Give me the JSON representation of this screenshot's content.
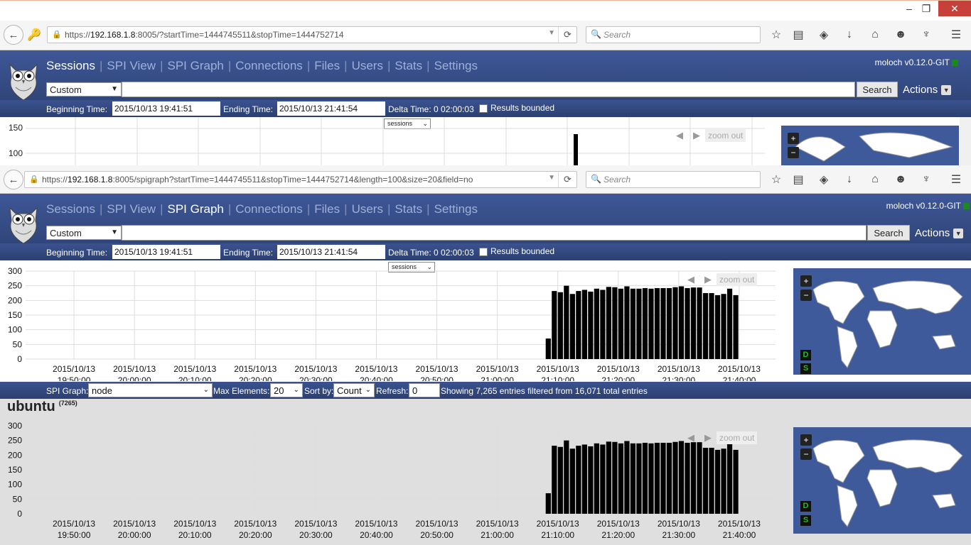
{
  "window": {
    "minimize": "–",
    "restore": "❐",
    "close": "✕"
  },
  "top_browser": {
    "url_host": "192.168.1.8",
    "url_scheme": "https://",
    "url_rest": ":8005/?startTime=1444745511&stopTime=1444752714",
    "search_placeholder": "Search"
  },
  "bottom_browser": {
    "url_host": "192.168.1.8",
    "url_scheme": "https://",
    "url_rest": ":8005/spigraph?startTime=1444745511&stopTime=1444752714&length=100&size=20&field=no",
    "search_placeholder": "Search"
  },
  "nav": [
    "Sessions",
    "SPI View",
    "SPI Graph",
    "Connections",
    "Files",
    "Users",
    "Stats",
    "Settings"
  ],
  "top_active": "Sessions",
  "bottom_active": "SPI Graph",
  "version": "moloch v0.12.0-GIT",
  "time_select": "Custom",
  "search_button": "Search",
  "actions": "Actions",
  "timebar": {
    "begin_label": "Beginning Time:",
    "begin_value": "2015/10/13 19:41:51",
    "end_label": "Ending Time:",
    "end_value": "2015/10/13 21:41:54",
    "delta": "Delta Time: 0 02:00:03",
    "bounded": "Results bounded"
  },
  "graph_select": "sessions",
  "zoom_out": "zoom out",
  "top_graph": {
    "yticks": [
      "150",
      "100"
    ],
    "bar_value": 138
  },
  "spi_controls": {
    "spi_graph_label": "SPI Graph:",
    "field_value": "node",
    "max_label": "Max Elements:",
    "max_value": "20",
    "sort_label": "Sort by:",
    "sort_value": "Count",
    "refresh_label": "Refresh:",
    "refresh_value": "0",
    "showing": "Showing 7,265 entries filtered from 16,071 total entries"
  },
  "node": {
    "name": "ubuntu",
    "count": "(7265)"
  },
  "map_buttons": {
    "plus": "+",
    "minus": "−",
    "d": "D",
    "s": "S"
  },
  "chart_data": [
    {
      "type": "bar",
      "title": "",
      "ylim": [
        0,
        300
      ],
      "yticks": [
        "300",
        "250",
        "200",
        "150",
        "100",
        "50",
        "0"
      ],
      "xticks": [
        "2015/10/13\n19:50:00",
        "2015/10/13\n20:00:00",
        "2015/10/13\n20:10:00",
        "2015/10/13\n20:20:00",
        "2015/10/13\n20:30:00",
        "2015/10/13\n20:40:00",
        "2015/10/13\n20:50:00",
        "2015/10/13\n21:00:00",
        "2015/10/13\n21:10:00",
        "2015/10/13\n21:20:00",
        "2015/10/13\n21:30:00",
        "2015/10/13\n21:40:00"
      ],
      "x_start_minute": 86,
      "values": [
        70,
        232,
        228,
        250,
        222,
        232,
        236,
        230,
        240,
        236,
        246,
        245,
        240,
        248,
        240,
        240,
        242,
        240,
        242,
        242,
        242,
        245,
        248,
        242,
        244,
        244,
        225,
        225,
        218,
        222,
        240,
        218
      ]
    },
    {
      "type": "bar",
      "title": "",
      "ylim": [
        0,
        300
      ],
      "yticks": [
        "300",
        "250",
        "200",
        "150",
        "100",
        "50",
        "0"
      ],
      "xticks": [
        "2015/10/13\n19:50:00",
        "2015/10/13\n20:00:00",
        "2015/10/13\n20:10:00",
        "2015/10/13\n20:20:00",
        "2015/10/13\n20:30:00",
        "2015/10/13\n20:40:00",
        "2015/10/13\n20:50:00",
        "2015/10/13\n21:00:00",
        "2015/10/13\n21:10:00",
        "2015/10/13\n21:20:00",
        "2015/10/13\n21:30:00",
        "2015/10/13\n21:40:00"
      ],
      "x_start_minute": 86,
      "values": [
        70,
        232,
        228,
        250,
        222,
        232,
        236,
        230,
        240,
        236,
        246,
        245,
        240,
        248,
        240,
        240,
        242,
        240,
        242,
        242,
        242,
        245,
        248,
        242,
        244,
        244,
        225,
        225,
        218,
        222,
        240,
        218
      ]
    }
  ]
}
